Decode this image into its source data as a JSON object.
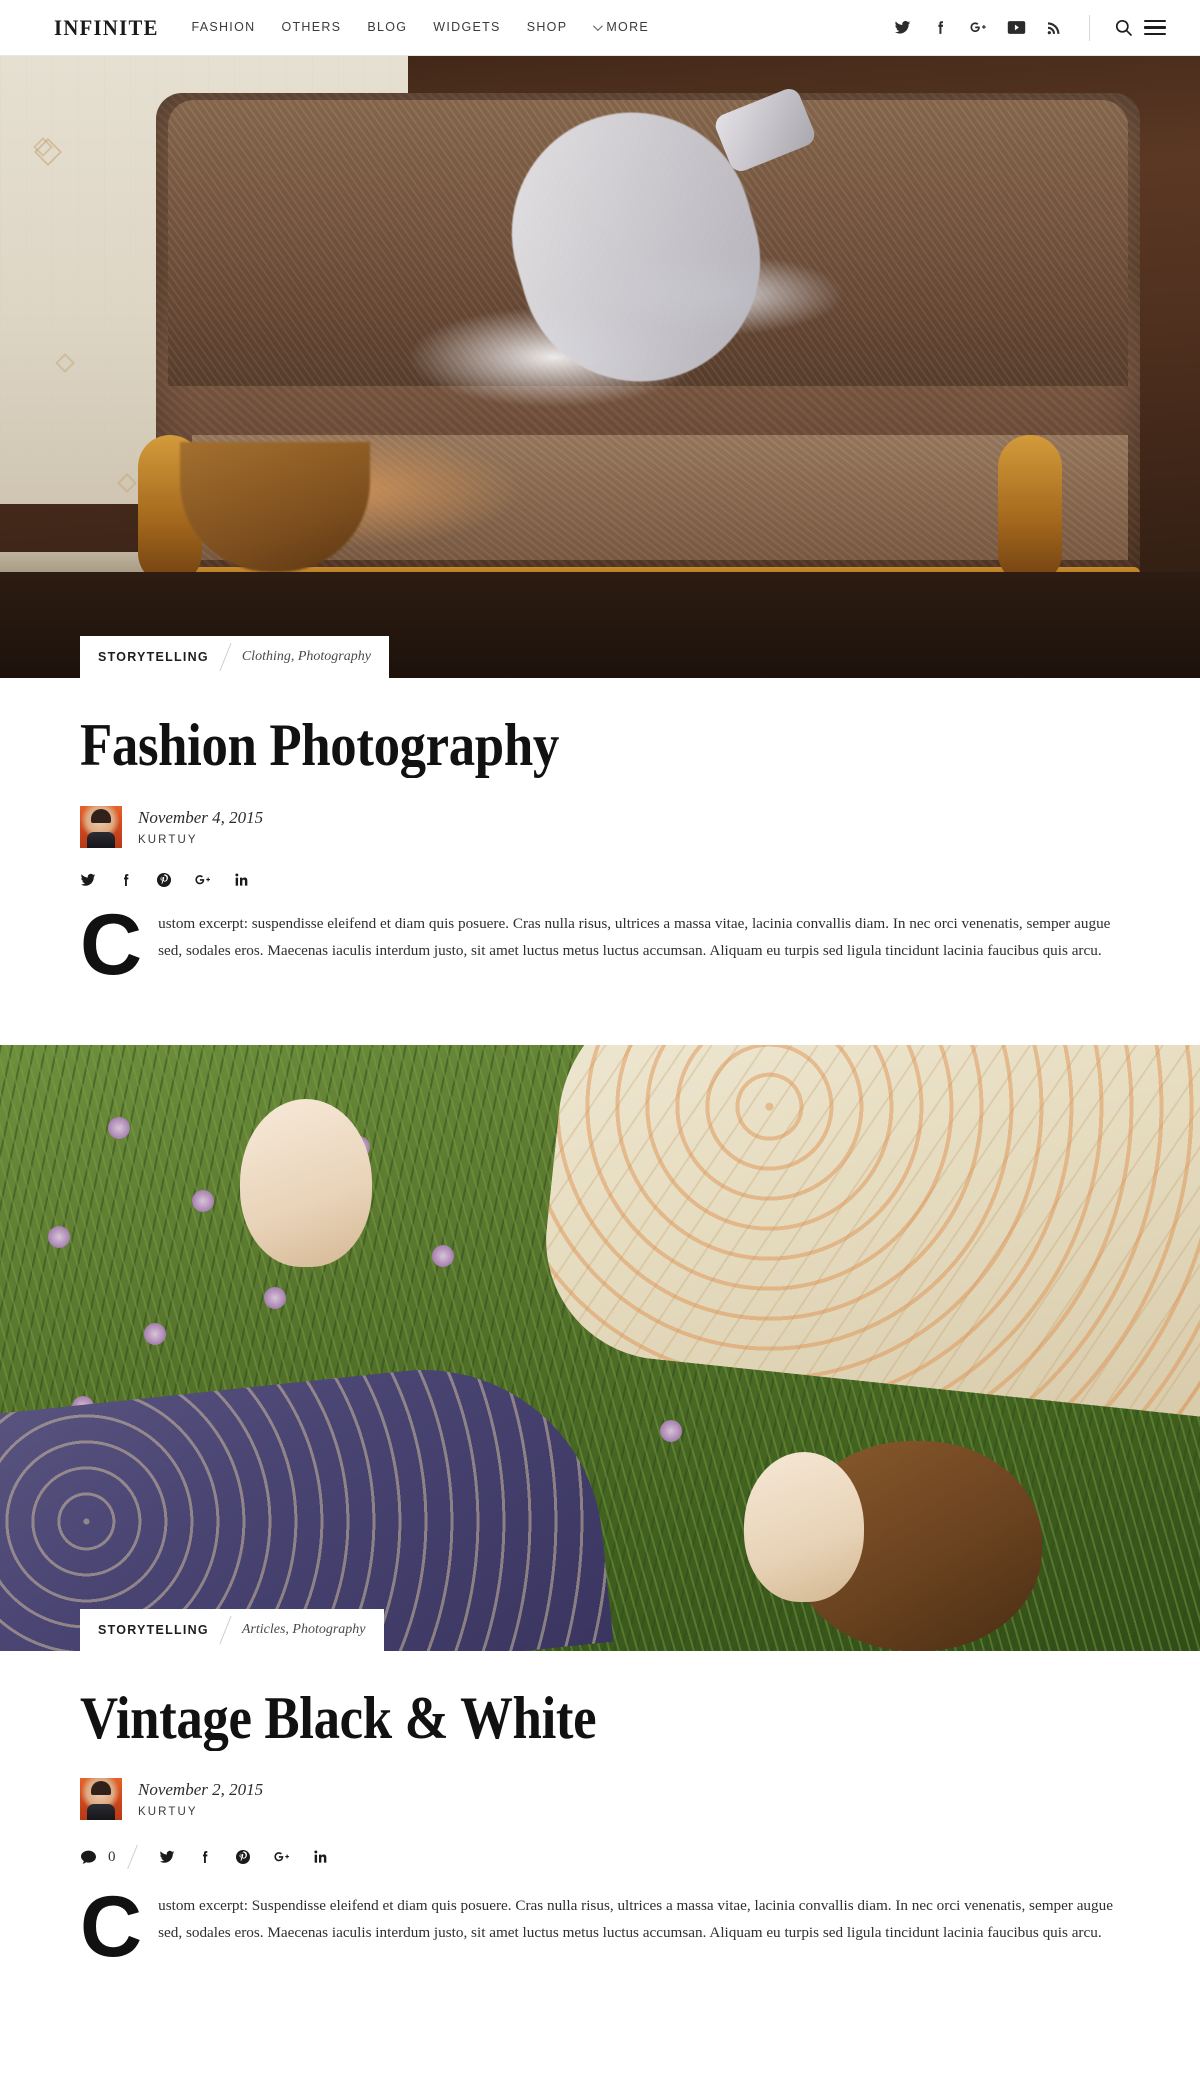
{
  "header": {
    "brand": "INFINITE",
    "nav": [
      {
        "label": "FASHION"
      },
      {
        "label": "OTHERS"
      },
      {
        "label": "BLOG"
      },
      {
        "label": "WIDGETS"
      },
      {
        "label": "SHOP"
      },
      {
        "label": "MORE"
      }
    ],
    "social": [
      {
        "name": "twitter-icon",
        "label": "Twitter"
      },
      {
        "name": "facebook-icon",
        "label": "Facebook"
      },
      {
        "name": "google-plus-icon",
        "label": "Google Plus"
      },
      {
        "name": "youtube-icon",
        "label": "YouTube"
      },
      {
        "name": "rss-icon",
        "label": "RSS"
      }
    ],
    "search_label": "Search",
    "menu_label": "Menu"
  },
  "posts": [
    {
      "category": "STORYTELLING",
      "tags": "Clothing, Photography",
      "title": "Fashion Photography",
      "date": "November 4, 2015",
      "author": "KURTUY",
      "has_comments": false,
      "comment_count": "",
      "dropcap": "C",
      "excerpt": "ustom excerpt: suspendisse eleifend et diam quis posuere. Cras nulla risus, ultrices a massa vitae, lacinia convallis diam. In nec orci venenatis, semper augue sed, sodales eros. Maecenas iaculis interdum justo, sit amet luctus metus luctus accumsan. Aliquam eu turpis sed ligula tincidunt lacinia faucibus quis arcu.",
      "share": [
        {
          "name": "twitter-icon"
        },
        {
          "name": "facebook-icon"
        },
        {
          "name": "pinterest-icon"
        },
        {
          "name": "google-plus-icon"
        },
        {
          "name": "linkedin-icon"
        }
      ]
    },
    {
      "category": "STORYTELLING",
      "tags": "Articles, Photography",
      "title": "Vintage Black & White",
      "date": "November 2, 2015",
      "author": "KURTUY",
      "has_comments": true,
      "comment_count": "0",
      "dropcap": "C",
      "excerpt": "ustom excerpt: Suspendisse eleifend et diam quis posuere. Cras nulla risus, ultrices a massa vitae, lacinia convallis diam. In nec orci venenatis, semper augue sed, sodales eros. Maecenas iaculis interdum justo, sit amet luctus metus luctus accumsan. Aliquam eu turpis sed ligula tincidunt lacinia faucibus quis arcu.",
      "share": [
        {
          "name": "twitter-icon"
        },
        {
          "name": "facebook-icon"
        },
        {
          "name": "pinterest-icon"
        },
        {
          "name": "google-plus-icon"
        },
        {
          "name": "linkedin-icon"
        }
      ]
    }
  ],
  "colors": {
    "text": "#111111",
    "muted": "#4a4a4a",
    "border": "#e8e8e8",
    "background": "#ffffff"
  }
}
